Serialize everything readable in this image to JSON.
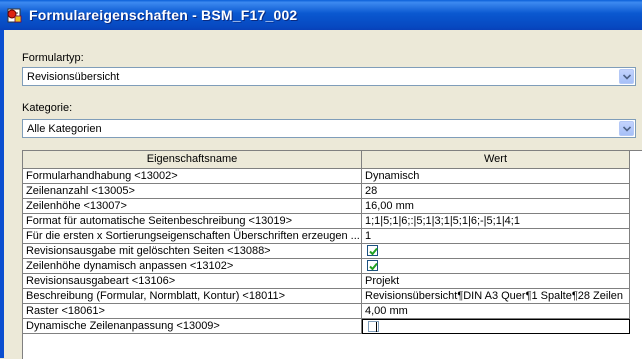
{
  "window": {
    "title": "Formulareigenschaften - BSM_F17_002",
    "icon": "form-app-icon"
  },
  "formulartyp": {
    "label": "Formulartyp:",
    "value": "Revisionsübersicht"
  },
  "kategorie": {
    "label": "Kategorie:",
    "value": "Alle Kategorien"
  },
  "table": {
    "headers": {
      "name": "Eigenschaftsname",
      "value": "Wert"
    },
    "rows": [
      {
        "name": "Formularhandhabung <13002>",
        "value": "Dynamisch",
        "type": "text"
      },
      {
        "name": "Zeilenanzahl <13005>",
        "value": "28",
        "type": "text"
      },
      {
        "name": "Zeilenhöhe <13007>",
        "value": "16,00 mm",
        "type": "text"
      },
      {
        "name": "Format für automatische Seitenbeschreibung <13019>",
        "value": "1;1|5;1|6;:|5;1|3;1|5;1|6;-|5;1|4;1",
        "type": "text"
      },
      {
        "name": "Für die ersten x Sortierungseigenschaften Überschriften erzeugen ...",
        "value": "1",
        "type": "text"
      },
      {
        "name": "Revisionsausgabe mit gelöschten Seiten <13088>",
        "value": "",
        "type": "checkbox",
        "checked": true
      },
      {
        "name": "Zeilenhöhe dynamisch anpassen <13102>",
        "value": "",
        "type": "checkbox",
        "checked": true
      },
      {
        "name": "Revisionsausgabeart <13106>",
        "value": "Projekt",
        "type": "text"
      },
      {
        "name": "Beschreibung (Formular, Normblatt, Kontur) <18011>",
        "value": "Revisionsübersicht¶DIN A3 Quer¶1 Spalte¶28 Zeilen",
        "type": "text"
      },
      {
        "name": "Raster <18061>",
        "value": "4,00 mm",
        "type": "text"
      },
      {
        "name": "Dynamische Zeilenanpassung <13009>",
        "value": "",
        "type": "checkbox-edit",
        "checked": false
      }
    ]
  },
  "colors": {
    "titlebar": "#0a58d0",
    "dialog": "#ece9d8",
    "checkmark": "#21a121"
  }
}
